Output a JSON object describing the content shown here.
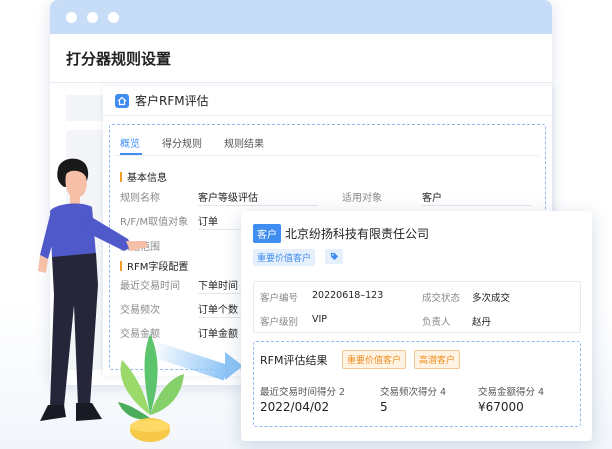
{
  "window": {
    "title": "打分器规则设置"
  },
  "panel": {
    "title": "客户RFM评估",
    "tabs": [
      {
        "label": "概览"
      },
      {
        "label": "得分规则"
      },
      {
        "label": "规则结果"
      }
    ],
    "basic": {
      "title": "基本信息",
      "rule_name_label": "规则名称",
      "rule_name_value": "客户等级评估",
      "target_label": "适用对象",
      "target_value": "客户",
      "rfm_field_label": "R/F/M取值对象",
      "rfm_field_value": "订单",
      "data_range_label": "数据范围"
    },
    "rfm_fields": {
      "title": "RFM字段配置",
      "recent_label": "最近交易时间",
      "recent_value": "下单时间",
      "freq_label": "交易频次",
      "freq_value": "订单个数",
      "amount_label": "交易金额",
      "amount_value": "订单金额"
    }
  },
  "card": {
    "badge": "客户",
    "company": "北京纷扬科技有限责任公司",
    "tag_primary": "重要价值客户",
    "info": {
      "id_label": "客户编号",
      "id_value": "20220618–123",
      "status_label": "成交状态",
      "status_value": "多次成交",
      "level_label": "客户级别",
      "level_value": "VIP",
      "owner_label": "负责人",
      "owner_value": "赵丹"
    },
    "rfm": {
      "title": "RFM评估结果",
      "tag1": "重要价值客户",
      "tag2": "高潜客户",
      "recent_label": "最近交易时间得分 2",
      "recent_value": "2022/04/02",
      "freq_label": "交易频次得分 4",
      "freq_value": "5",
      "amount_label": "交易金额得分 4",
      "amount_value": "¥67000"
    }
  },
  "icons": {
    "panel_icon": "home-icon",
    "tag_icon": "tag-icon",
    "accent_color": "#3f8df1",
    "orange_color": "#f08c1e"
  }
}
